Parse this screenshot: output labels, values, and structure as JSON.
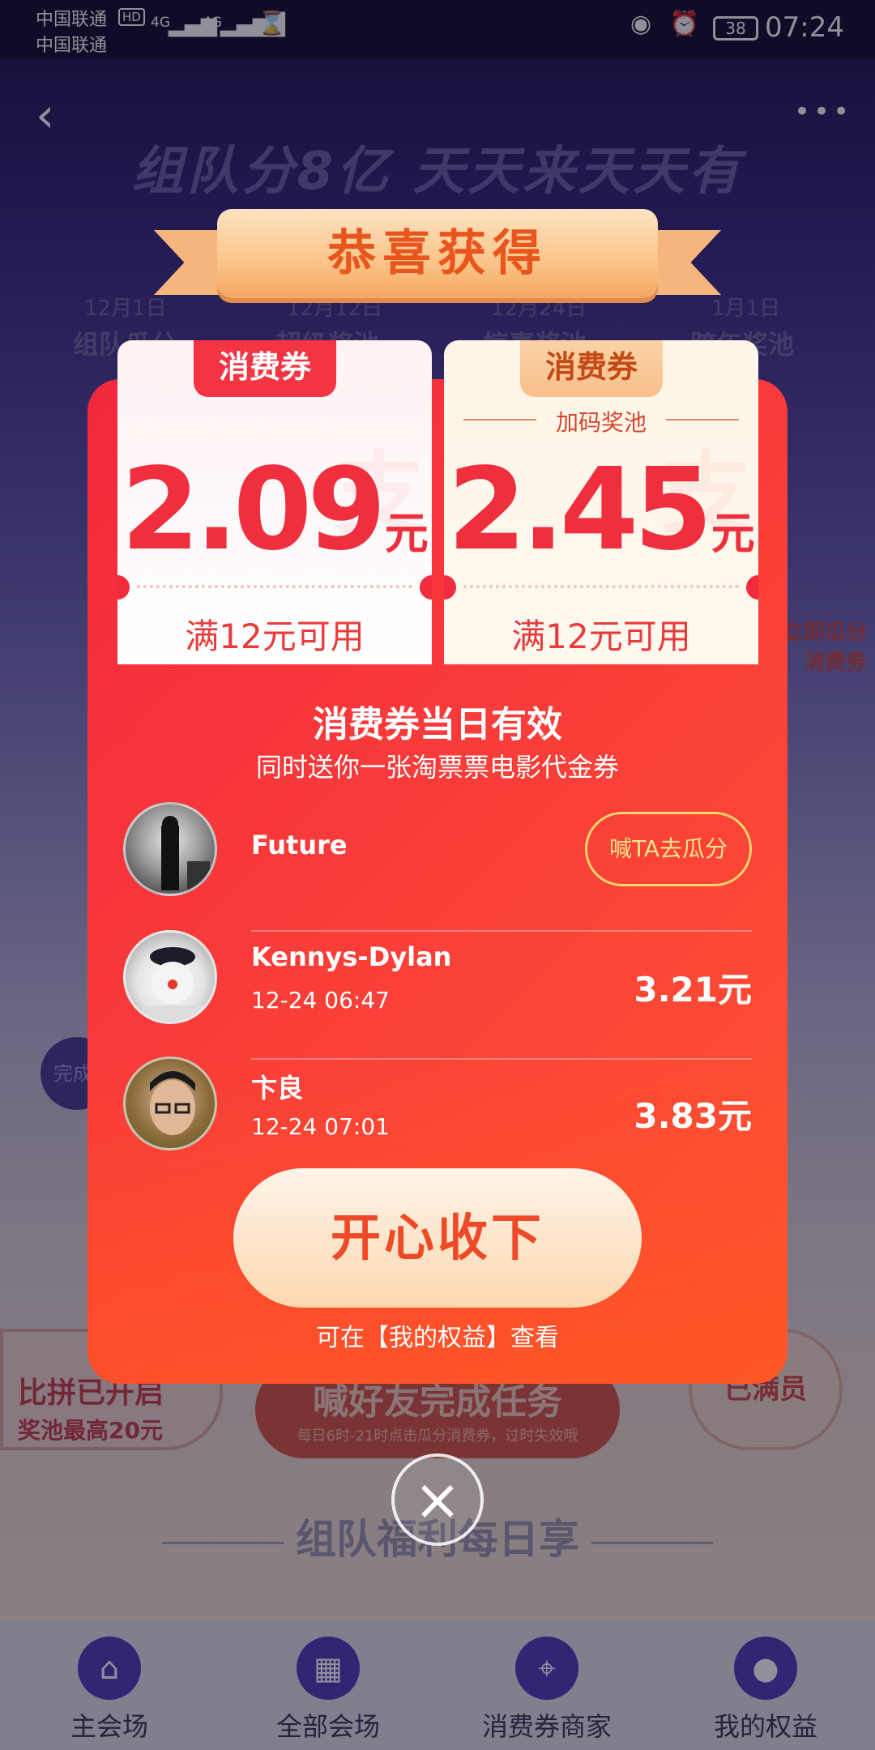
{
  "status_bar": {
    "carrier_1": "中国联通",
    "carrier_2": "中国联通",
    "hd": "HD",
    "net_1": "4G",
    "net_2": "4G",
    "battery": "38",
    "time": "07:24"
  },
  "background": {
    "headline": "组队分8亿 天天来天天有",
    "dates": [
      "12月1日",
      "12月12日",
      "12月24日",
      "1月1日"
    ],
    "pools": [
      "组队瓜分",
      "超级奖池",
      "惊喜奖池",
      "跨年奖池"
    ],
    "side_tag": "立即瓜分\n消费券",
    "left_circle": "完成",
    "left_badge_line1": "比拼已开启",
    "left_badge_line2": "奖池最高20元",
    "mid_badge_line1": "喊好友完成任务",
    "mid_badge_line2": "每日6时-21时点击瓜分消费券，过时失效哦",
    "right_badge": "已满员",
    "section_title": "组队福利每日享"
  },
  "modal": {
    "ribbon_title": "恭喜获得",
    "coupons": [
      {
        "tag": "消费券",
        "subtitle": "",
        "amount": "2.09",
        "unit": "元",
        "condition": "满12元可用",
        "watermark": "支"
      },
      {
        "tag": "消费券",
        "subtitle": "加码奖池",
        "amount": "2.45",
        "unit": "元",
        "condition": "满12元可用",
        "watermark": "支"
      }
    ],
    "valid_title": "消费券当日有效",
    "valid_sub": "同时送你一张淘票票电影代金券",
    "members": [
      {
        "name": "Future",
        "button": "喊TA去瓜分"
      },
      {
        "name": "Kennys-Dylan",
        "time": "12-24 06:47",
        "amount": "3.21元"
      },
      {
        "name": "卞良",
        "time": "12-24 07:01",
        "amount": "3.83元"
      }
    ],
    "accept_button": "开心收下",
    "accept_hint": "可在【我的权益】查看"
  },
  "tabs": [
    {
      "label": "主会场",
      "icon": "home-icon"
    },
    {
      "label": "全部会场",
      "icon": "grid-icon"
    },
    {
      "label": "消费券商家",
      "icon": "location-pin-icon"
    },
    {
      "label": "我的权益",
      "icon": "user-icon"
    }
  ]
}
